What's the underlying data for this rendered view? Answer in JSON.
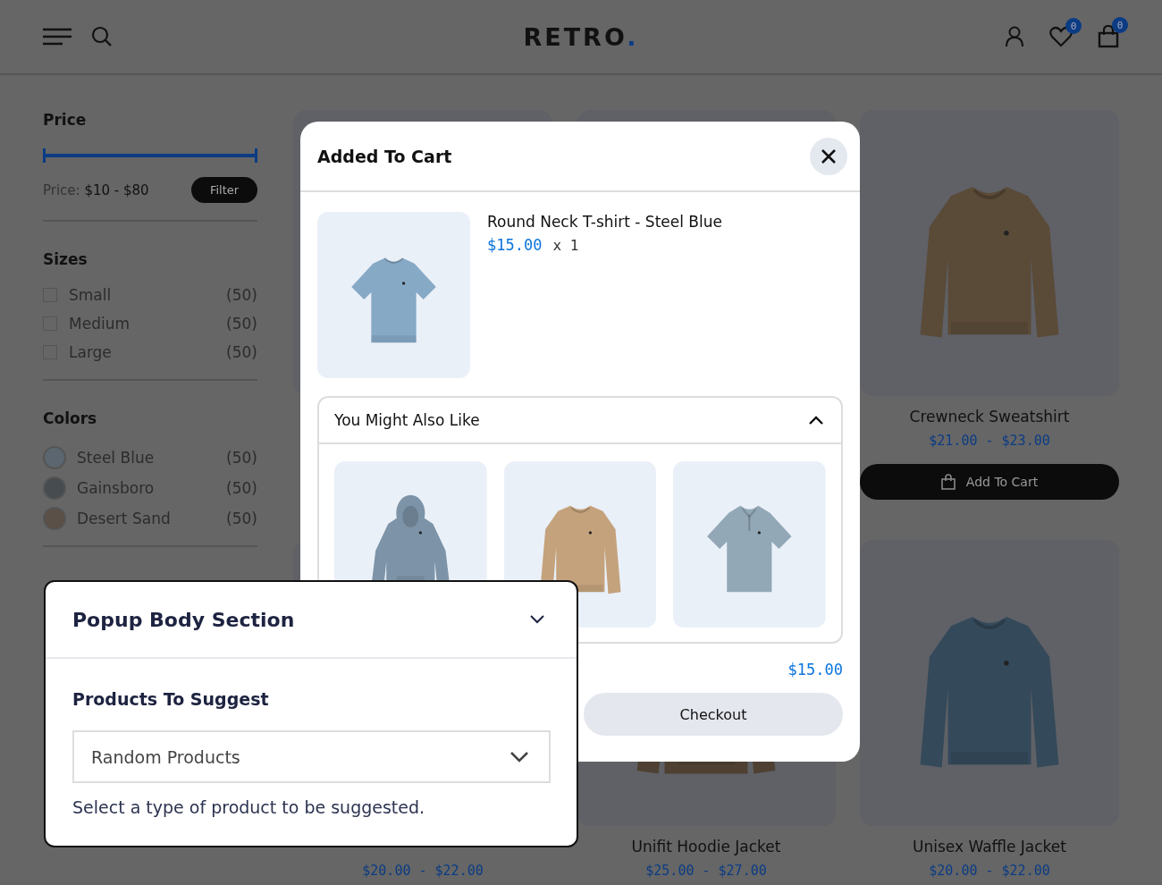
{
  "header": {
    "logo": {
      "text": "RETRO",
      "mark": "."
    },
    "wishlist_count": "0",
    "cart_count": "0"
  },
  "sidebar": {
    "price": {
      "title": "Price",
      "slider": {
        "level": 1
      },
      "label": "Price: **$10 - $80**",
      "button": "Filter"
    },
    "sizes": {
      "title": "Sizes",
      "items": [
        {
          "label": "Small",
          "count": "(50)",
          "checked": false
        },
        {
          "label": "Medium",
          "count": "(50)",
          "checked": false
        },
        {
          "label": "Large",
          "count": "(50)",
          "checked": false
        }
      ]
    },
    "colors": {
      "title": "Colors",
      "items": [
        {
          "label": "Steel Blue",
          "count": "(50)",
          "color": "#5b6670"
        },
        {
          "label": "Gainsboro",
          "count": "(50)",
          "color": "#474c50"
        },
        {
          "label": "Desert Sand",
          "count": "(50)",
          "color": "#5a5047"
        }
      ]
    }
  },
  "products": [
    {
      "kind": "card"
    },
    {
      "kind": "card"
    },
    {
      "kind": "card",
      "name": "Crewneck Sweatshirt",
      "price": "$21.00 - $23.00",
      "button": "Add To Cart"
    },
    {
      "kind": "card",
      "price": "$20.00 - $22.00"
    },
    {
      "kind": "card",
      "name": "Unifit Hoodie Jacket",
      "price": "$25.00 - $27.00"
    },
    {
      "kind": "card",
      "name": "Unisex Waffle Jacket",
      "price": "$20.00 - $22.00"
    }
  ],
  "cart_popup": {
    "title": "Added To Cart",
    "item": {
      "name": "Round Neck T-shirt - Steel Blue",
      "price": "$15.00",
      "quantity": "x 1"
    },
    "suggestions": {
      "title": "You Might Also Like",
      "expanded": true
    },
    "total": "$15.00",
    "checkout": "Checkout"
  },
  "settings_panel": {
    "title": "Popup Body Section",
    "field_label": "Products To Suggest",
    "select": {
      "value": "Random Products"
    },
    "help": "Select a type of product to be suggested."
  }
}
